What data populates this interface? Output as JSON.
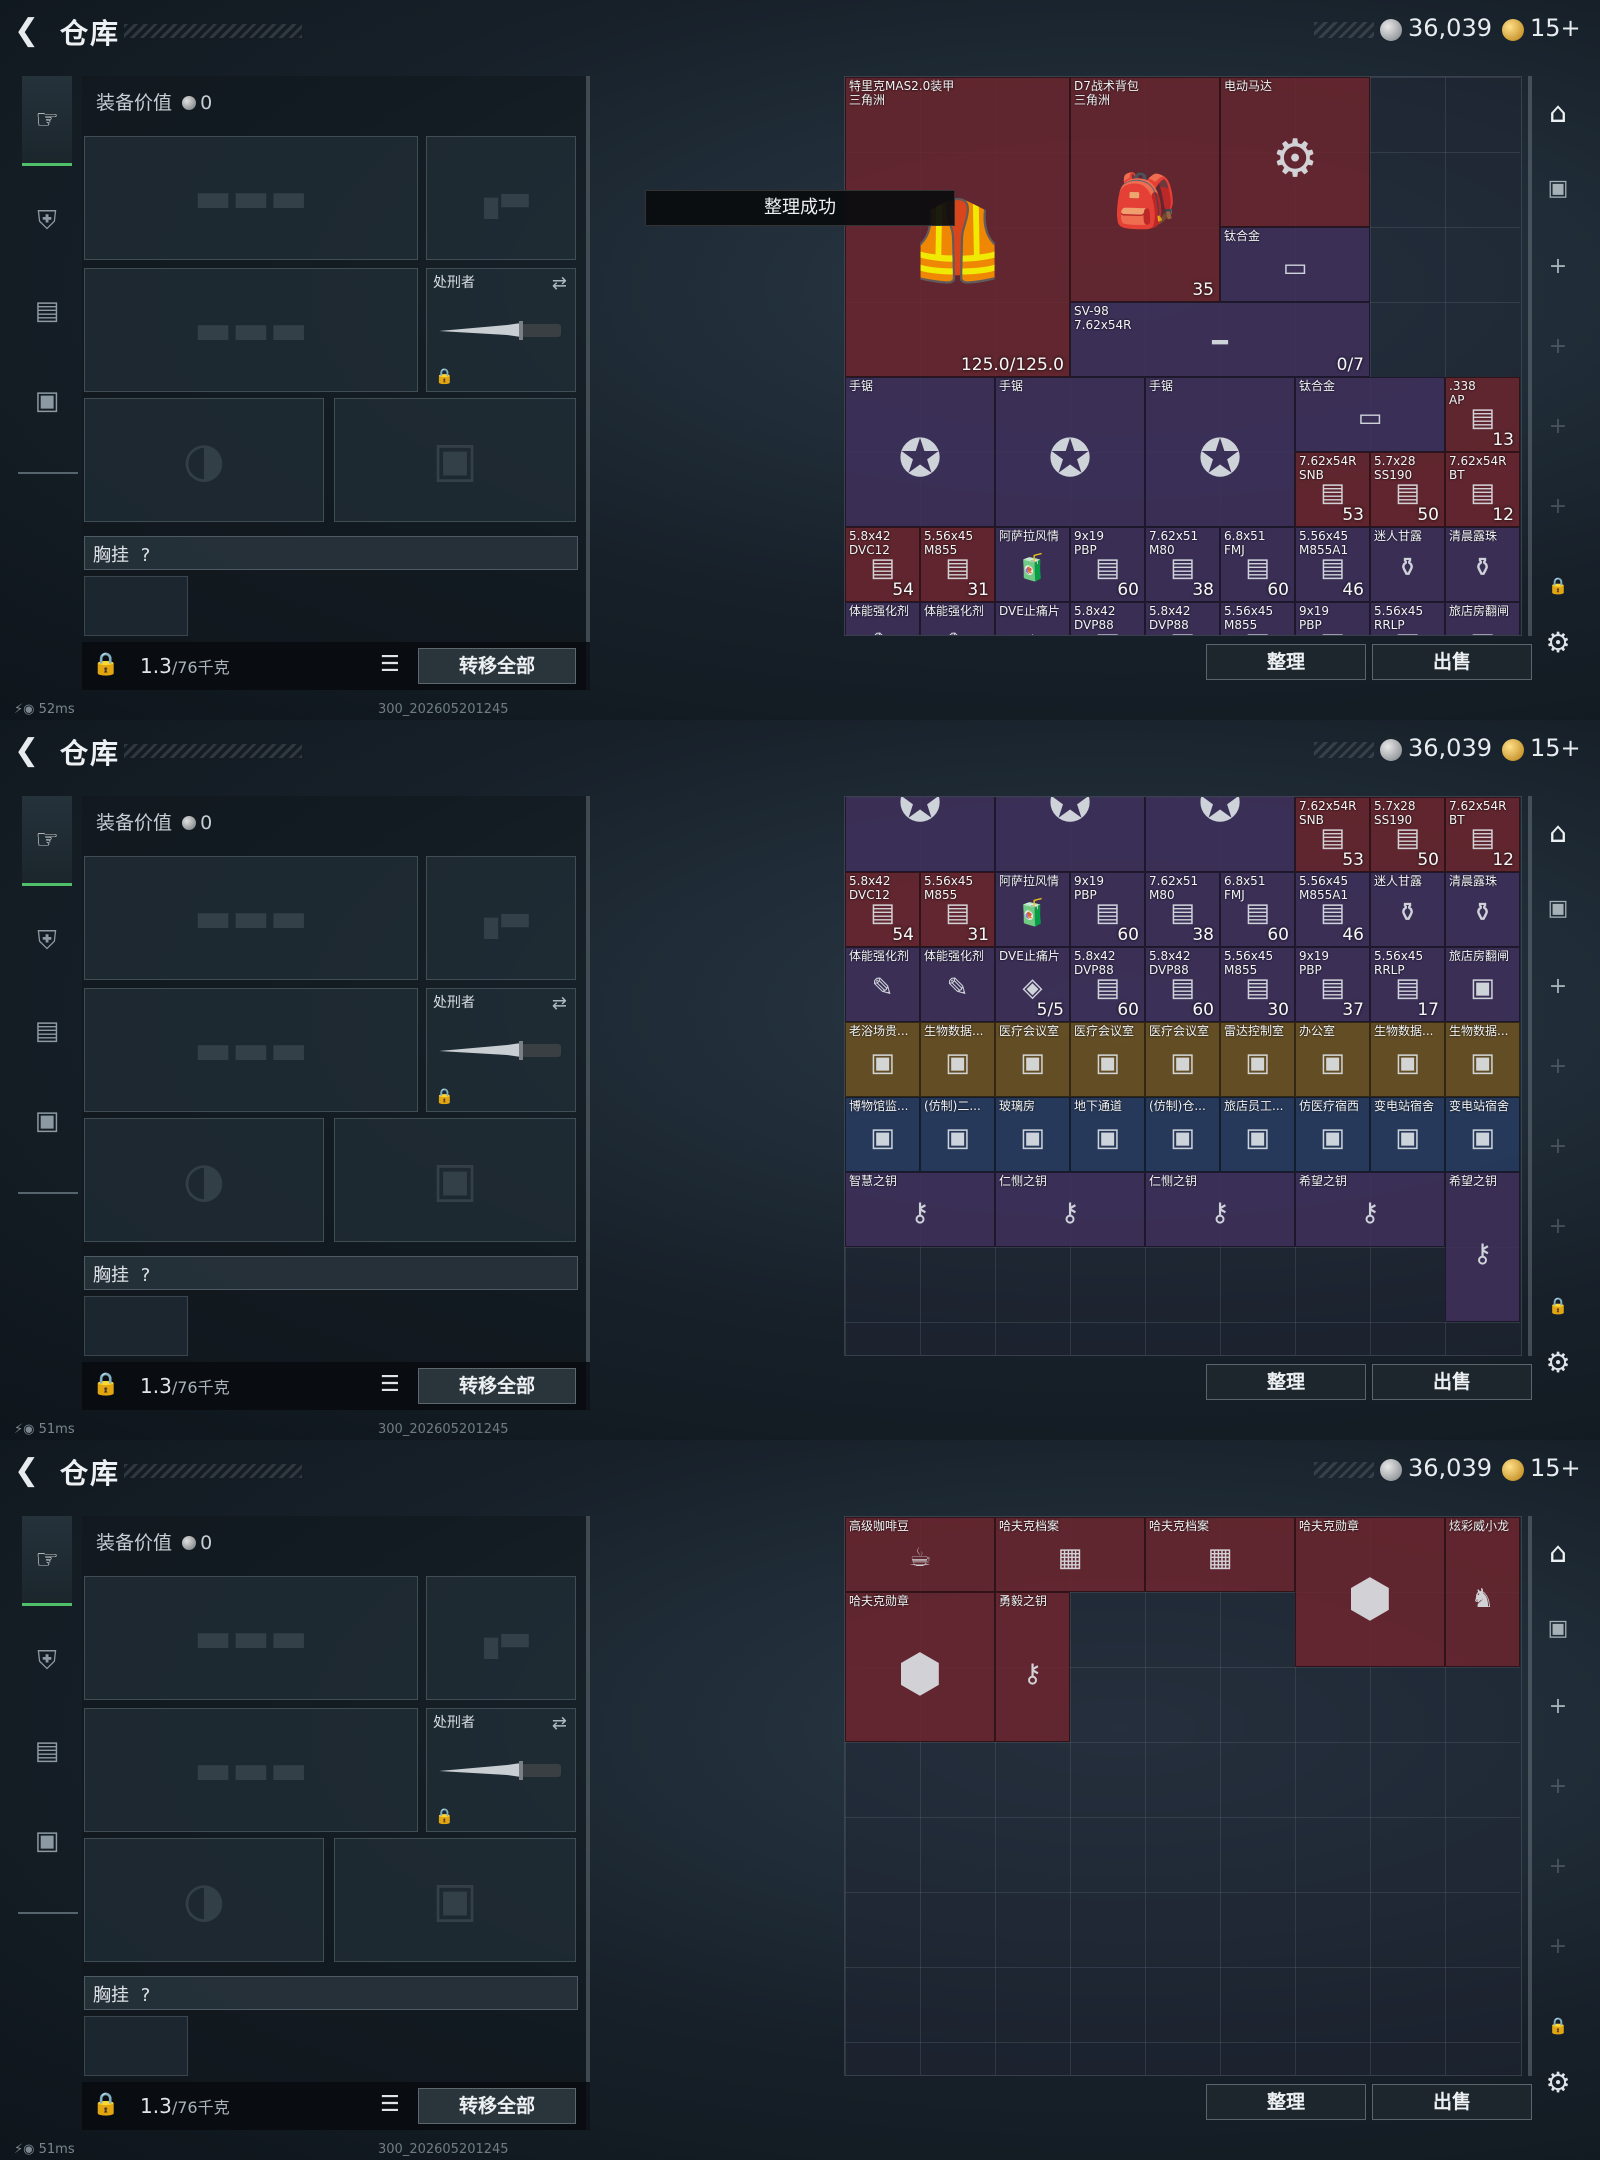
{
  "app": {
    "title": "仓库",
    "currency": {
      "silver": "36,039",
      "gold": "15+"
    }
  },
  "equipment": {
    "value_label": "装备价值",
    "value": "0",
    "knife_label": "处刑者",
    "chest_label": "胸挂",
    "chest_help": "?",
    "weight": "1.3",
    "weight_unit": "/76千克",
    "transfer_label": "转移全部"
  },
  "inventory": {
    "sort_label": "整理",
    "sell_label": "出售"
  },
  "toast": "整理成功",
  "screens": [
    {
      "status": "52ms",
      "version": "300_202605201245",
      "items": [
        {
          "name": "特里克MAS2.0装甲",
          "sub": "三角洲",
          "count": "125.0/125.0",
          "tint": "c-red",
          "icon": "armor-icon"
        },
        {
          "name": "D7战术背包",
          "sub": "三角洲",
          "count": "35",
          "tint": "c-red",
          "icon": "backpack-icon"
        },
        {
          "name": "电动马达",
          "sub": "",
          "count": "",
          "tint": "c-red",
          "icon": "motor-icon"
        },
        {
          "name": "钛合金",
          "sub": "",
          "count": "",
          "tint": "c-purple",
          "icon": "ingot-icon"
        },
        {
          "name": "SV-98",
          "sub": "7.62x54R",
          "count": "0/7",
          "tint": "c-purple",
          "icon": "rifle-icon"
        },
        {
          "name": "手锯",
          "sub": "",
          "count": "",
          "tint": "c-purple",
          "icon": "saw-icon"
        },
        {
          "name": "手锯",
          "sub": "",
          "count": "",
          "tint": "c-purple",
          "icon": "saw-icon"
        },
        {
          "name": "手锯",
          "sub": "",
          "count": "",
          "tint": "c-purple",
          "icon": "saw-icon"
        },
        {
          "name": "钛合金",
          "sub": "",
          "count": "",
          "tint": "c-purple",
          "icon": "ingot-icon"
        },
        {
          "name": ".338",
          "sub": "AP",
          "count": "13",
          "tint": "c-red",
          "icon": "ammo-icon"
        },
        {
          "name": "7.62x54R",
          "sub": "SNB",
          "count": "53",
          "tint": "c-red",
          "icon": "ammo-icon"
        },
        {
          "name": "5.7x28",
          "sub": "SS190",
          "count": "50",
          "tint": "c-red",
          "icon": "ammo-icon"
        },
        {
          "name": "7.62x54R",
          "sub": "BT",
          "count": "12",
          "tint": "c-red",
          "icon": "ammo-icon"
        },
        {
          "name": "5.8x42",
          "sub": "DVC12",
          "count": "54",
          "tint": "c-red",
          "icon": "ammo-icon"
        },
        {
          "name": "5.56x45",
          "sub": "M855",
          "count": "31",
          "tint": "c-red",
          "icon": "ammo-icon"
        },
        {
          "name": "阿萨拉风情",
          "sub": "",
          "count": "",
          "tint": "c-purple",
          "icon": "drink-icon"
        },
        {
          "name": "9x19",
          "sub": "PBP",
          "count": "60",
          "tint": "c-purple",
          "icon": "ammo-icon"
        },
        {
          "name": "7.62x51",
          "sub": "M80",
          "count": "38",
          "tint": "c-purple",
          "icon": "ammo-icon"
        },
        {
          "name": "6.8x51",
          "sub": "FMJ",
          "count": "60",
          "tint": "c-purple",
          "icon": "ammo-icon"
        },
        {
          "name": "5.56x45",
          "sub": "M855A1",
          "count": "46",
          "tint": "c-purple",
          "icon": "ammo-icon"
        },
        {
          "name": "迷人甘露",
          "sub": "",
          "count": "",
          "tint": "c-purple",
          "icon": "jar-icon"
        },
        {
          "name": "清晨露珠",
          "sub": "",
          "count": "",
          "tint": "c-purple",
          "icon": "jar-icon"
        },
        {
          "name": "体能强化剂",
          "sub": "",
          "count": "",
          "tint": "c-purple",
          "icon": "syringe-icon"
        },
        {
          "name": "体能强化剂",
          "sub": "",
          "count": "",
          "tint": "c-purple",
          "icon": "syringe-icon"
        },
        {
          "name": "DVE止痛片",
          "sub": "",
          "count": "",
          "tint": "c-purple",
          "icon": "pill-icon"
        },
        {
          "name": "5.8x42",
          "sub": "DVP88",
          "count": "",
          "tint": "c-purple",
          "icon": "ammo-icon"
        },
        {
          "name": "5.8x42",
          "sub": "DVP88",
          "count": "",
          "tint": "c-purple",
          "icon": "ammo-icon"
        },
        {
          "name": "5.56x45",
          "sub": "M855",
          "count": "",
          "tint": "c-purple",
          "icon": "ammo-icon"
        },
        {
          "name": "9x19",
          "sub": "PBP",
          "count": "",
          "tint": "c-purple",
          "icon": "ammo-icon"
        },
        {
          "name": "5.56x45",
          "sub": "RRLP",
          "count": "",
          "tint": "c-purple",
          "icon": "ammo-icon"
        },
        {
          "name": "旅店房翻闸",
          "sub": "",
          "count": "",
          "tint": "c-purple",
          "icon": "keycard-icon"
        }
      ]
    },
    {
      "status": "51ms",
      "version": "300_202605201245",
      "items": [
        {
          "name": "",
          "sub": "",
          "count": "",
          "tint": "c-purple",
          "icon": "saw-icon"
        },
        {
          "name": "",
          "sub": "",
          "count": "",
          "tint": "c-purple",
          "icon": "saw-icon"
        },
        {
          "name": "",
          "sub": "",
          "count": "",
          "tint": "c-purple",
          "icon": "saw-icon"
        },
        {
          "name": "7.62x54R",
          "sub": "SNB",
          "count": "53",
          "tint": "c-red",
          "icon": "ammo-icon"
        },
        {
          "name": "5.7x28",
          "sub": "SS190",
          "count": "50",
          "tint": "c-red",
          "icon": "ammo-icon"
        },
        {
          "name": "7.62x54R",
          "sub": "BT",
          "count": "12",
          "tint": "c-red",
          "icon": "ammo-icon"
        },
        {
          "name": "5.8x42",
          "sub": "DVC12",
          "count": "54",
          "tint": "c-red",
          "icon": "ammo-icon"
        },
        {
          "name": "5.56x45",
          "sub": "M855",
          "count": "31",
          "tint": "c-red",
          "icon": "ammo-icon"
        },
        {
          "name": "阿萨拉风情",
          "sub": "",
          "count": "",
          "tint": "c-purple",
          "icon": "drink-icon"
        },
        {
          "name": "9x19",
          "sub": "PBP",
          "count": "60",
          "tint": "c-purple",
          "icon": "ammo-icon"
        },
        {
          "name": "7.62x51",
          "sub": "M80",
          "count": "38",
          "tint": "c-purple",
          "icon": "ammo-icon"
        },
        {
          "name": "6.8x51",
          "sub": "FMJ",
          "count": "60",
          "tint": "c-purple",
          "icon": "ammo-icon"
        },
        {
          "name": "5.56x45",
          "sub": "M855A1",
          "count": "46",
          "tint": "c-purple",
          "icon": "ammo-icon"
        },
        {
          "name": "迷人甘露",
          "sub": "",
          "count": "",
          "tint": "c-purple",
          "icon": "jar-icon"
        },
        {
          "name": "清晨露珠",
          "sub": "",
          "count": "",
          "tint": "c-purple",
          "icon": "jar-icon"
        },
        {
          "name": "体能强化剂",
          "sub": "",
          "count": "",
          "tint": "c-purple",
          "icon": "syringe-icon"
        },
        {
          "name": "体能强化剂",
          "sub": "",
          "count": "",
          "tint": "c-purple",
          "icon": "syringe-icon"
        },
        {
          "name": "DVE止痛片",
          "sub": "",
          "count": "5/5",
          "tint": "c-purple",
          "icon": "pill-icon"
        },
        {
          "name": "5.8x42",
          "sub": "DVP88",
          "count": "60",
          "tint": "c-purple",
          "icon": "ammo-icon"
        },
        {
          "name": "5.8x42",
          "sub": "DVP88",
          "count": "60",
          "tint": "c-purple",
          "icon": "ammo-icon"
        },
        {
          "name": "5.56x45",
          "sub": "M855",
          "count": "30",
          "tint": "c-purple",
          "icon": "ammo-icon"
        },
        {
          "name": "9x19",
          "sub": "PBP",
          "count": "37",
          "tint": "c-purple",
          "icon": "ammo-icon"
        },
        {
          "name": "5.56x45",
          "sub": "RRLP",
          "count": "17",
          "tint": "c-purple",
          "icon": "ammo-icon"
        },
        {
          "name": "旅店房翻闸",
          "sub": "",
          "count": "",
          "tint": "c-purple",
          "icon": "keycard-icon"
        },
        {
          "name": "老浴场贵...",
          "sub": "",
          "count": "",
          "tint": "c-gold",
          "icon": "keycard-icon"
        },
        {
          "name": "生物数据...",
          "sub": "",
          "count": "",
          "tint": "c-gold",
          "icon": "keycard-icon"
        },
        {
          "name": "医疗会议室",
          "sub": "",
          "count": "",
          "tint": "c-gold",
          "icon": "keycard-icon"
        },
        {
          "name": "医疗会议室",
          "sub": "",
          "count": "",
          "tint": "c-gold",
          "icon": "keycard-icon"
        },
        {
          "name": "医疗会议室",
          "sub": "",
          "count": "",
          "tint": "c-gold",
          "icon": "keycard-icon"
        },
        {
          "name": "雷达控制室",
          "sub": "",
          "count": "",
          "tint": "c-gold",
          "icon": "keycard-icon"
        },
        {
          "name": "办公室",
          "sub": "",
          "count": "",
          "tint": "c-gold",
          "icon": "keycard-icon"
        },
        {
          "name": "生物数据...",
          "sub": "",
          "count": "",
          "tint": "c-gold",
          "icon": "keycard-icon"
        },
        {
          "name": "生物数据...",
          "sub": "",
          "count": "",
          "tint": "c-gold",
          "icon": "keycard-icon"
        },
        {
          "name": "博物馆监...",
          "sub": "",
          "count": "",
          "tint": "c-blue",
          "icon": "keycard-icon"
        },
        {
          "name": "(仿制)二...",
          "sub": "",
          "count": "",
          "tint": "c-blue",
          "icon": "keycard-icon"
        },
        {
          "name": "玻璃房",
          "sub": "",
          "count": "",
          "tint": "c-blue",
          "icon": "keycard-icon"
        },
        {
          "name": "地下通道",
          "sub": "",
          "count": "",
          "tint": "c-blue",
          "icon": "keycard-icon"
        },
        {
          "name": "(仿制)仓...",
          "sub": "",
          "count": "",
          "tint": "c-blue",
          "icon": "keycard-icon"
        },
        {
          "name": "旅店员工...",
          "sub": "",
          "count": "",
          "tint": "c-blue",
          "icon": "keycard-icon"
        },
        {
          "name": "仿医疗宿西",
          "sub": "",
          "count": "",
          "tint": "c-blue",
          "icon": "keycard-icon"
        },
        {
          "name": "变电站宿舍",
          "sub": "",
          "count": "",
          "tint": "c-blue",
          "icon": "keycard-icon"
        },
        {
          "name": "变电站宿舍",
          "sub": "",
          "count": "",
          "tint": "c-blue",
          "icon": "keycard-icon"
        },
        {
          "name": "智慧之钥",
          "sub": "",
          "count": "",
          "tint": "c-purple",
          "icon": "key-icon"
        },
        {
          "name": "仁恻之钥",
          "sub": "",
          "count": "",
          "tint": "c-purple",
          "icon": "key-icon"
        },
        {
          "name": "仁恻之钥",
          "sub": "",
          "count": "",
          "tint": "c-purple",
          "icon": "key-icon"
        },
        {
          "name": "希望之钥",
          "sub": "",
          "count": "",
          "tint": "c-purple",
          "icon": "key-icon"
        },
        {
          "name": "希望之钥",
          "sub": "",
          "count": "",
          "tint": "c-purple",
          "icon": "key-icon"
        }
      ]
    },
    {
      "status": "51ms",
      "version": "300_202605201245",
      "items": [
        {
          "name": "高级咖啡豆",
          "sub": "",
          "count": "",
          "tint": "c-red",
          "icon": "coffee-icon"
        },
        {
          "name": "哈夫克档案",
          "sub": "",
          "count": "",
          "tint": "c-red",
          "icon": "file-icon"
        },
        {
          "name": "哈夫克档案",
          "sub": "",
          "count": "",
          "tint": "c-red",
          "icon": "file-icon"
        },
        {
          "name": "哈夫克勋章",
          "sub": "",
          "count": "",
          "tint": "c-red",
          "icon": "medal-icon"
        },
        {
          "name": "炫彩威小龙",
          "sub": "",
          "count": "",
          "tint": "c-red",
          "icon": "figurine-icon"
        },
        {
          "name": "哈夫克勋章",
          "sub": "",
          "count": "",
          "tint": "c-red",
          "icon": "medal-icon"
        },
        {
          "name": "勇毅之钥",
          "sub": "",
          "count": "",
          "tint": "c-red",
          "icon": "key-icon"
        }
      ]
    }
  ]
}
